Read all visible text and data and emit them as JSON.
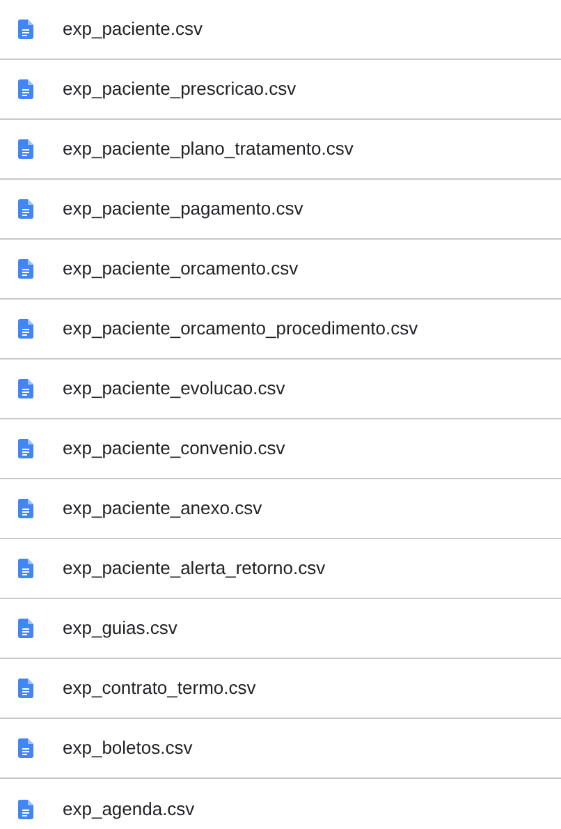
{
  "files": [
    {
      "name": "exp_paciente.csv"
    },
    {
      "name": "exp_paciente_prescricao.csv"
    },
    {
      "name": "exp_paciente_plano_tratamento.csv"
    },
    {
      "name": "exp_paciente_pagamento.csv"
    },
    {
      "name": "exp_paciente_orcamento.csv"
    },
    {
      "name": "exp_paciente_orcamento_procedimento.csv"
    },
    {
      "name": "exp_paciente_evolucao.csv"
    },
    {
      "name": "exp_paciente_convenio.csv"
    },
    {
      "name": "exp_paciente_anexo.csv"
    },
    {
      "name": "exp_paciente_alerta_retorno.csv"
    },
    {
      "name": "exp_guias.csv"
    },
    {
      "name": "exp_contrato_termo.csv"
    },
    {
      "name": "exp_boletos.csv"
    },
    {
      "name": "exp_agenda.csv"
    }
  ]
}
